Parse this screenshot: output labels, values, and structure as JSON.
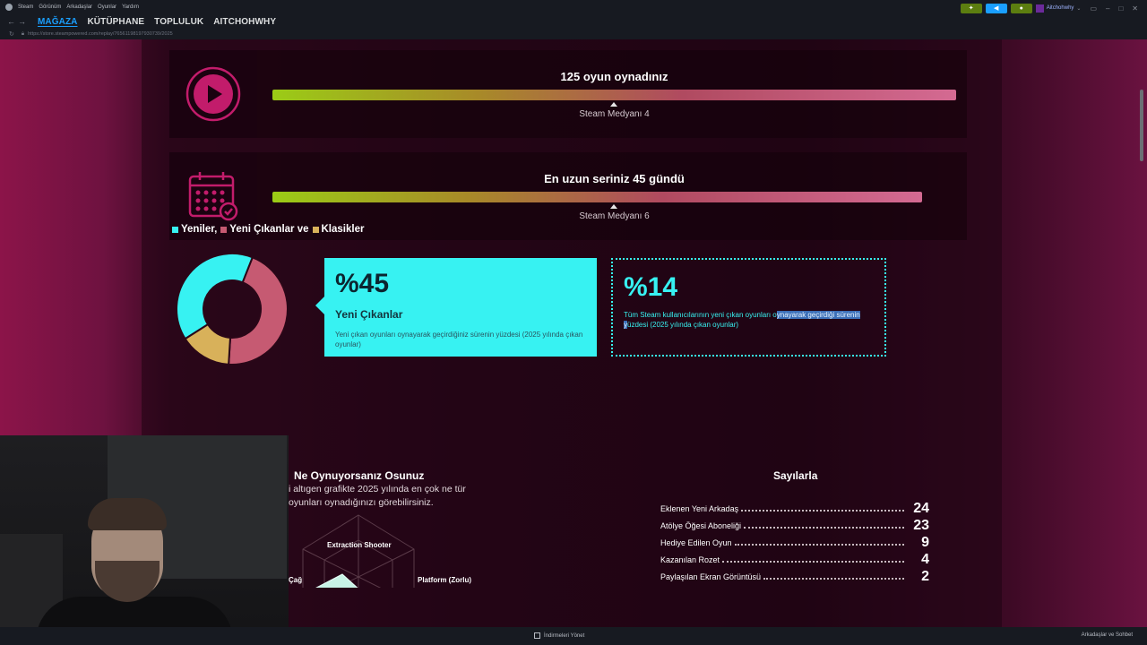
{
  "titlebar": {
    "menu": [
      "Steam",
      "Görünüm",
      "Arkadaşlar",
      "Oyunlar",
      "Yardım"
    ]
  },
  "topright": {
    "username": "Aitchohwhy"
  },
  "nav": {
    "tabs": [
      "MAĞAZA",
      "KÜTÜPHANE",
      "TOPLULUK",
      "AITCHOHWHY"
    ],
    "active_tab": "MAĞAZA"
  },
  "url": "https://store.steampowered.com/replay/76561198197930739/2025",
  "games_played": {
    "title": "125 oyun oynadınız",
    "subtitle": "Steam Medyanı 4",
    "progress_fraction": 1.0
  },
  "streak": {
    "title": "En uzun seriniz 45 gündü",
    "subtitle": "Steam Medyanı 6",
    "progress_fraction": 0.95
  },
  "legend": {
    "items": [
      {
        "label": "Yeniler,",
        "color": "#37f2f2"
      },
      {
        "label": "Yeni Çıkanlar ve",
        "color": "#c65a72"
      },
      {
        "label": "Klasikler",
        "color": "#d8b15a"
      }
    ]
  },
  "chart_data": {
    "type": "pie",
    "title": "",
    "categories": [
      "Yeniler",
      "Yeni Çıkanlar",
      "Klasikler"
    ],
    "values": [
      40,
      45,
      15
    ],
    "colors": [
      "#37f2f2",
      "#c65a72",
      "#d8b15a"
    ],
    "donut": true
  },
  "card_new": {
    "big": "%45",
    "label": "Yeni Çıkanlar",
    "desc": "Yeni çıkan oyunları oynayarak geçirdiğiniz sürenin yüzdesi (2025 yılında çıkan oyunlar)"
  },
  "card_all": {
    "big": "%14",
    "desc_plain": "Tüm Steam kullanıcılarının yeni çıkan oyunları o",
    "desc_highlight": "ynayarak geçirdiği sürenin",
    "desc_highlight2": "y",
    "desc_rest": "üzdesi (2025 yılında çıkan oyunlar)"
  },
  "play_section": {
    "title": "Ne Oynuyorsanız Osunuz",
    "text": "i altıgen grafikte 2025 yılında en çok ne tür oyunları oynadığınızı görebilirsiniz.",
    "radar_labels": {
      "top": "Extraction Shooter",
      "right": "Platform (Zorlu)",
      "left": "Çağ"
    }
  },
  "numbers_section": {
    "title": "Sayılarla",
    "items": [
      {
        "name": "Eklenen Yeni Arkadaş",
        "value": "24"
      },
      {
        "name": "Atölye Öğesi Aboneliği",
        "value": "23"
      },
      {
        "name": "Hediye Edilen Oyun",
        "value": "9"
      },
      {
        "name": "Kazanılan Rozet",
        "value": "4"
      },
      {
        "name": "Paylaşılan Ekran Görüntüsü",
        "value": "2"
      }
    ]
  },
  "bottombar": {
    "downloads": "İndirmeleri Yönet",
    "friends": "Arkadaşlar ve Sohbet"
  }
}
